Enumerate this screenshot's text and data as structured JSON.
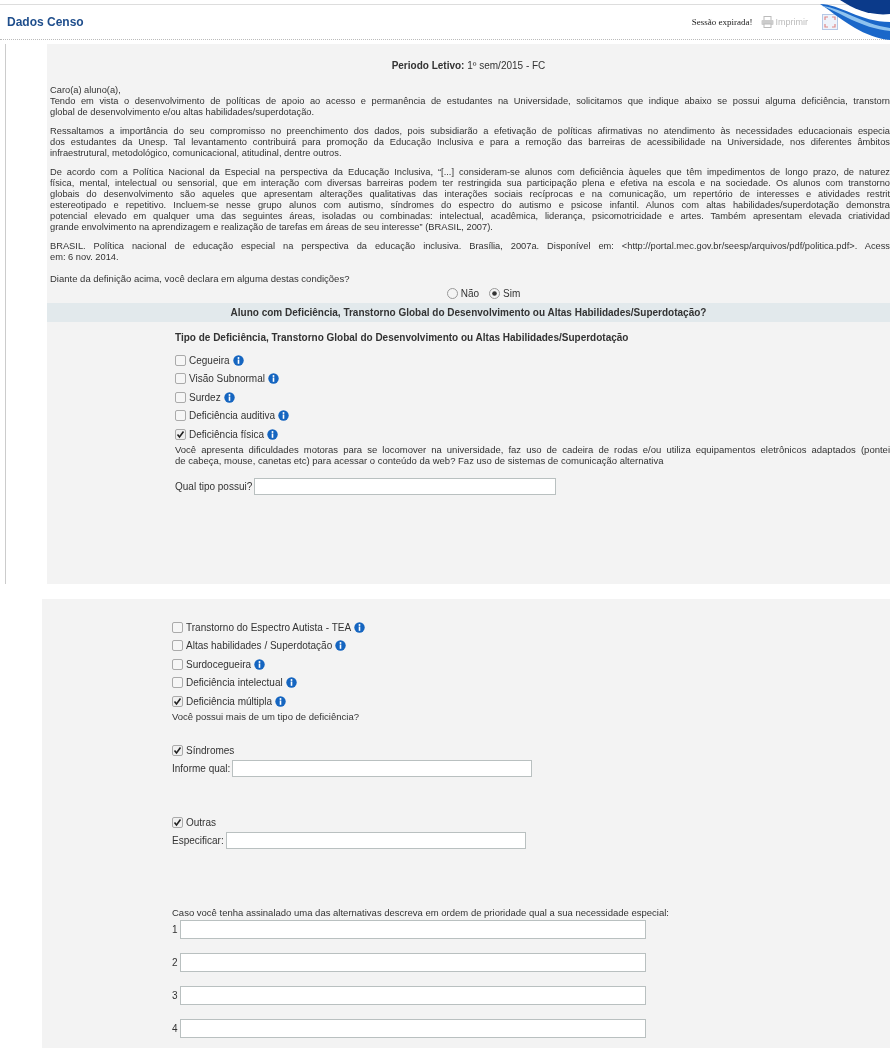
{
  "header": {
    "title": "Dados Censo",
    "session": "Sessão expirada!",
    "print": {
      "label": "Imprimir",
      "disabled": true
    }
  },
  "period": "**Periodo Letivo:** 1º sem/2015 - FC",
  "intro": [
    {
      "lines": [
        "Caro(a) aluno(a),"
      ]
    },
    {
      "lines": [
        "Tendo em vista o desenvolvimento de políticas de apoio ao acesso e permanência de estudantes na Universidade, solicitamos que indique abaixo se possui alguma deficiência, transtorn",
        "global de desenvolvimento e/ou altas habilidades/superdotação."
      ]
    },
    {
      "lines": [
        "Ressaltamos a importância do seu compromisso no preenchimento dos dados, pois subsidiarão a efetivação de políticas afirmativas no atendimento às necessidades educacionais especia",
        "dos estudantes da Unesp. Tal levantamento contribuirá para promoção da Educação Inclusiva e para a remoção das barreiras de acessibilidade na Universidade, nos diferentes âmbitos",
        "infraestrutural, metodológico, comunicacional, atitudinal, dentre outros."
      ]
    },
    {
      "lines": [
        "De acordo com a Política Nacional da Especial na perspectiva da Educação Inclusiva, “[...] consideram-se alunos com deficiência àqueles que têm impedimentos de longo prazo, de naturez",
        "física, mental, intelectual ou sensorial, que em interação com diversas barreiras podem ter restringida sua participação plena e efetiva na escola e na sociedade. Os alunos com transtorno",
        "globais do desenvolvimento são aqueles que apresentam alterações qualitativas das interações sociais recíprocas e na comunicação, um repertório de interesses e atividades restrit",
        "estereotipado e repetitivo. Incluem-se nesse grupo alunos com autismo, síndromes do espectro do autismo e psicose infantil. Alunos com altas habilidades/superdotação demonstra",
        "potencial elevado em qualquer uma das seguintes áreas, isoladas ou combinadas: intelectual, acadêmica, liderança, psicomotricidade e artes. Também apresentam elevada criatividad",
        "grande envolvimento na aprendizagem e realização de tarefas em áreas de seu interesse” (BRASIL, 2007)."
      ]
    },
    {
      "lines": [
        "BRASIL. Política nacional de educação especial na perspectiva da educação inclusiva. Brasília, 2007a. Disponível em: <http://portal.mec.gov.br/seesp/arquivos/pdf/politica.pdf>. Acess",
        "em: 6 nov. 2014."
      ]
    }
  ],
  "question": "Diante da definição acima, você declara em alguma destas condições?",
  "answer_options": [
    {
      "label": "Não",
      "selected": false
    },
    {
      "label": "Sim",
      "selected": true
    }
  ],
  "section_title": "Aluno com Deficiência, Transtorno Global do Desenvolvimento ou Altas Habilidades/Superdotação?",
  "subsection_title": "Tipo de Deficiência, Transtorno Global do Desenvolvimento ou Altas Habilidades/Superdotação",
  "types_part1": [
    {
      "label": "Cegueira",
      "checked": false
    },
    {
      "label": "Visão Subnormal",
      "checked": false
    },
    {
      "label": "Surdez",
      "checked": false
    },
    {
      "label": "Deficiência auditiva",
      "checked": false
    },
    {
      "label": "Deficiência física",
      "checked": true
    }
  ],
  "physical_note": {
    "lines": [
      "Você apresenta dificuldades motoras para se locomover na universidade, faz uso de cadeira de rodas e/ou utiliza equipamentos eletrônicos adaptados (pontei",
      "de cabeça, mouse, canetas etc) para acessar o conteúdo da web? Faz uso de sistemas de comunicação alternativa"
    ]
  },
  "type_field": {
    "label": "Qual tipo possui?"
  },
  "types_part2": [
    {
      "label": "Transtorno do Espectro Autista - TEA",
      "checked": false
    },
    {
      "label": "Altas habilidades / Superdotação",
      "checked": false
    },
    {
      "label": "Surdocegueira",
      "checked": false
    },
    {
      "label": "Deficiência intelectual",
      "checked": false
    },
    {
      "label": "Deficiência múltipla",
      "checked": true
    }
  ],
  "multiple_question": "Você possui mais de um tipo de deficiência?",
  "extra": [
    {
      "label": "Síndromes",
      "checked": true,
      "field_label": "Informe qual:"
    },
    {
      "label": "Outras",
      "checked": true,
      "field_label": "Especificar:"
    }
  ],
  "priority_prompt": "Caso você tenha assinalado uma das alternativas descreva em ordem de prioridade qual a sua necessidade especial:",
  "priority_fields": [
    {
      "number": "1"
    },
    {
      "number": "2"
    },
    {
      "number": "3"
    },
    {
      "number": "4"
    }
  ]
}
